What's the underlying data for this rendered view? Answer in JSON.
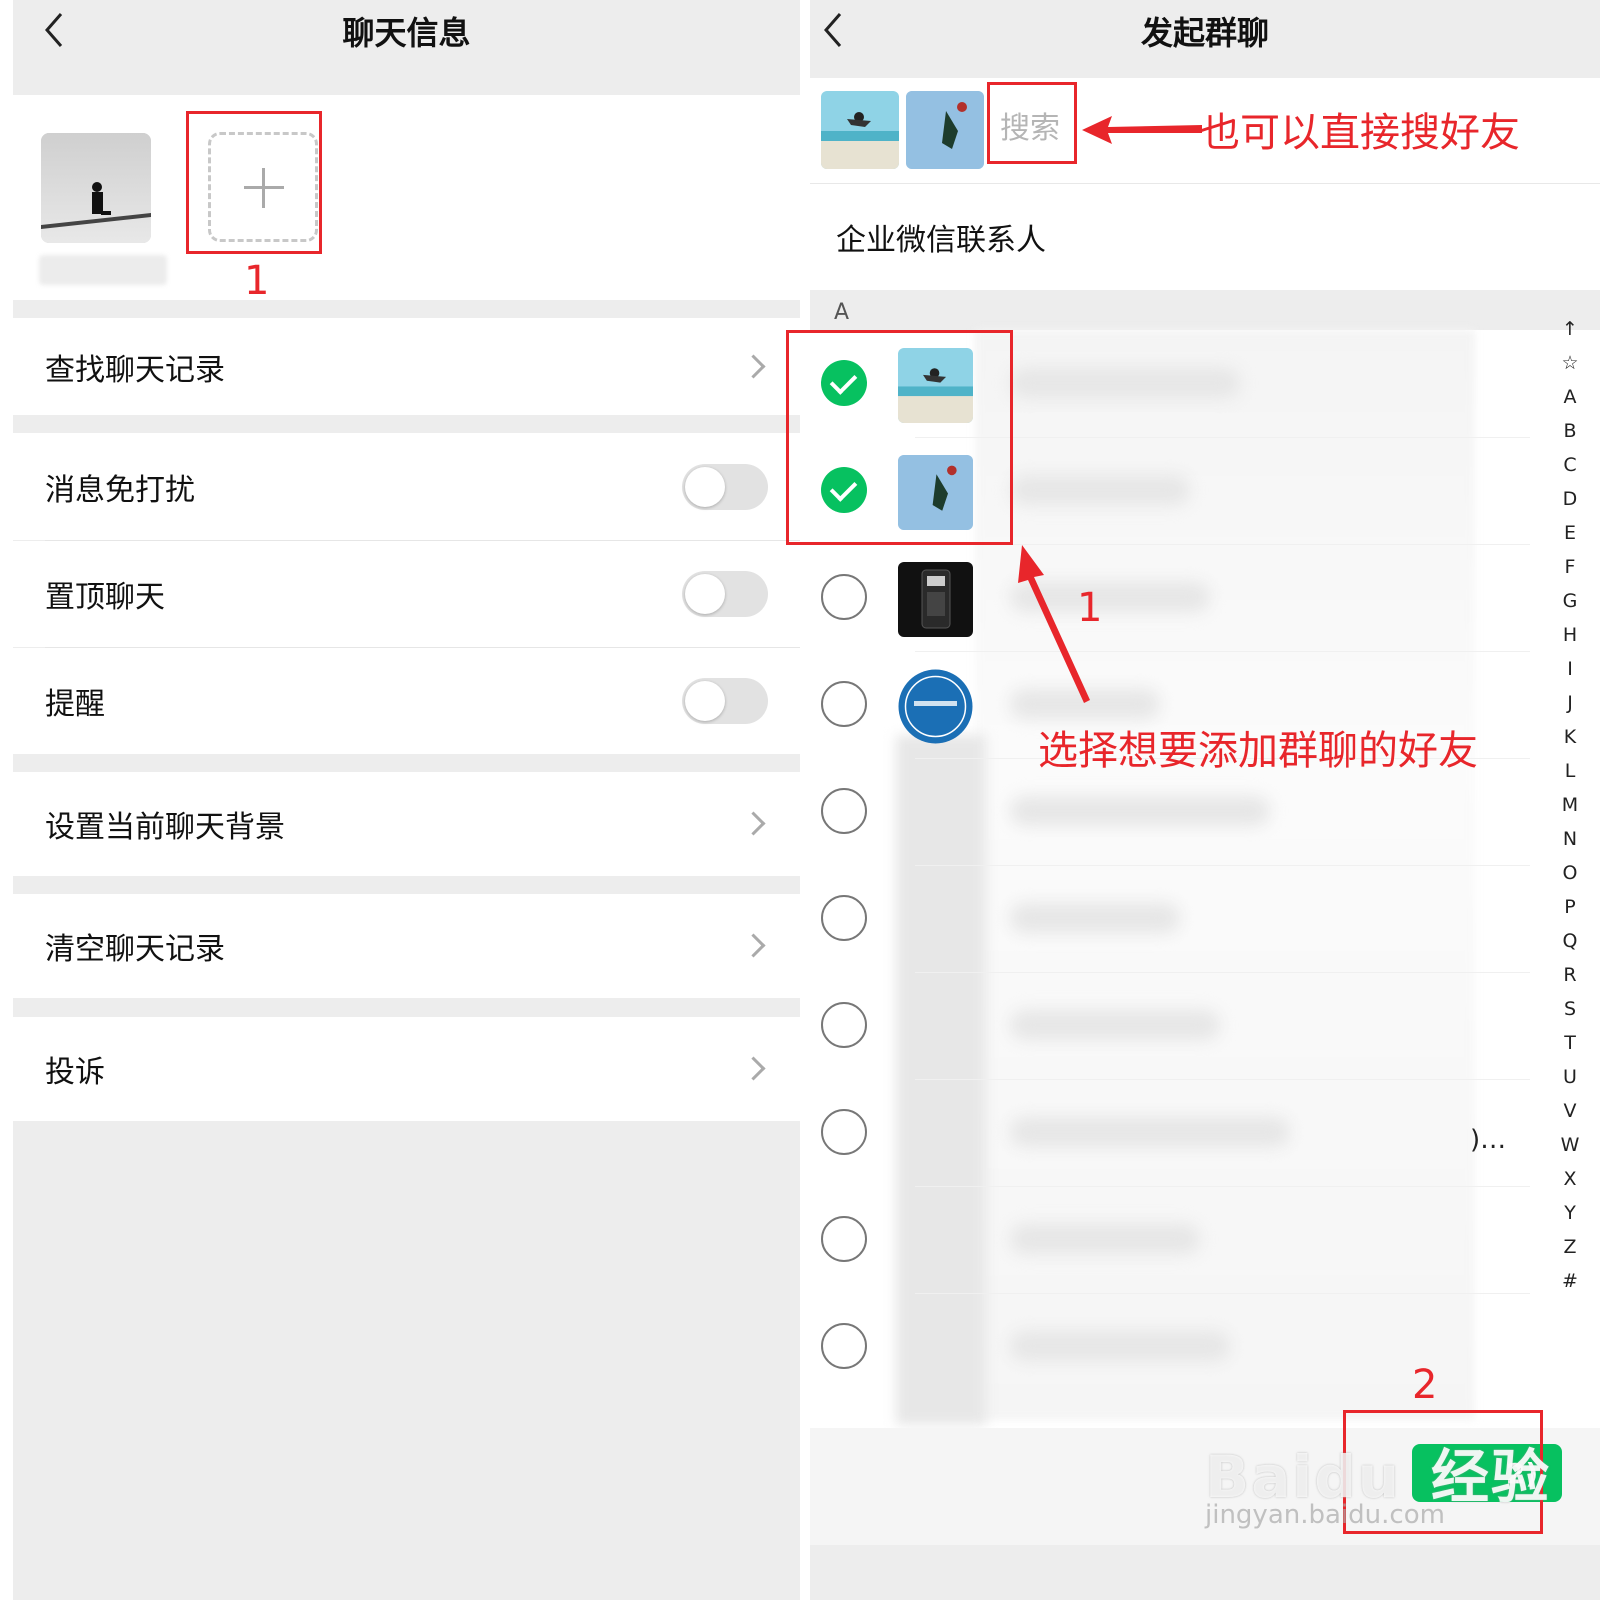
{
  "left_screen": {
    "title": "聊天信息",
    "menu": {
      "search_history": "查找聊天记录",
      "mute": "消息免打扰",
      "pin": "置顶聊天",
      "remind": "提醒",
      "background": "设置当前聊天背景",
      "clear": "清空聊天记录",
      "report": "投诉"
    },
    "toggles": {
      "mute": false,
      "pin": false,
      "remind": false
    }
  },
  "right_screen": {
    "title": "发起群聊",
    "search_placeholder": "搜索",
    "section_enterprise": "企业微信联系人",
    "alpha_header": "A",
    "overflow_text": ")…",
    "index_letters": [
      "↑",
      "☆",
      "A",
      "B",
      "C",
      "D",
      "E",
      "F",
      "G",
      "H",
      "I",
      "J",
      "K",
      "L",
      "M",
      "N",
      "O",
      "P",
      "Q",
      "R",
      "S",
      "T",
      "U",
      "V",
      "W",
      "X",
      "Y",
      "Z",
      "#"
    ],
    "rows_checked": [
      true,
      true,
      false,
      false,
      false,
      false,
      false,
      false,
      false,
      false
    ],
    "done_button_visible": "2)"
  },
  "annotations": {
    "num1_left": "1",
    "num1_right": "1",
    "num2_right": "2",
    "search_tip": "也可以直接搜好友",
    "select_tip": "选择想要添加群聊的好友"
  },
  "watermark": {
    "brand": "Baidu",
    "overlay": "经验",
    "url": "jingyan.baidu.com"
  },
  "colors": {
    "accent_green": "#07c160",
    "annotation_red": "#e8262b",
    "background_gray": "#ededed"
  }
}
